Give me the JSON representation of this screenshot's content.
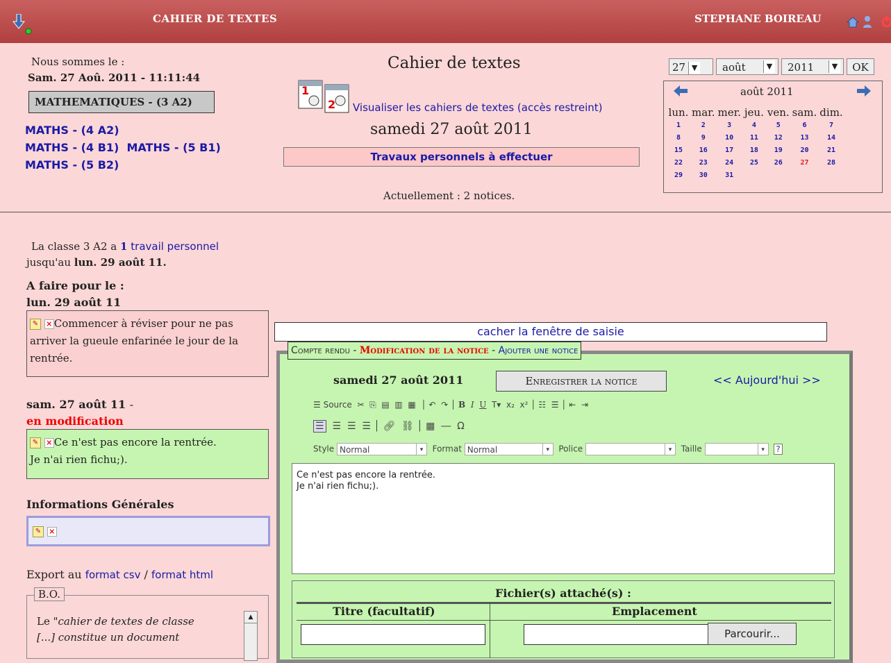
{
  "topbar": {
    "title": "CAHIER DE TEXTES",
    "user": "STEPHANE BOIREAU"
  },
  "header": {
    "date_intro": "Nous sommes le :",
    "datetime": "Sam. 27 Aoû. 2011 - 11:11:44",
    "current_class": "MATHEMATIQUES - (3 A2)",
    "other_classes": [
      "MATHS - (4 A2)",
      "MATHS - (4 B1)",
      "MATHS - (5 B1)",
      "MATHS - (5 B2)"
    ],
    "page_title": "Cahier de textes",
    "view_link": "Visualiser les cahiers de textes (accès restreint)",
    "selected_date": "samedi 27 août 2011",
    "travaux_button": "Travaux personnels à effectuer",
    "notices_count": "Actuellement : 2 notices."
  },
  "calendar": {
    "day_select": "27",
    "month_select": "août",
    "year_select": "2011",
    "ok_label": "OK",
    "month_title": "août 2011",
    "weekdays": [
      "lun.",
      "mar.",
      "mer.",
      "jeu.",
      "ven.",
      "sam.",
      "dim."
    ],
    "weeks": [
      [
        "1",
        "2",
        "3",
        "4",
        "5",
        "6",
        "7"
      ],
      [
        "8",
        "9",
        "10",
        "11",
        "12",
        "13",
        "14"
      ],
      [
        "15",
        "16",
        "17",
        "18",
        "19",
        "20",
        "21"
      ],
      [
        "22",
        "23",
        "24",
        "25",
        "26",
        "27",
        "28"
      ],
      [
        "29",
        "30",
        "31",
        "",
        "",
        "",
        ""
      ]
    ],
    "today": "27",
    "today_color": "#e02020"
  },
  "left": {
    "class_info_prefix": "La classe 3 A2 a",
    "count": "1",
    "travail_link": "travail personnel",
    "until_prefix": "jusqu'au",
    "until_date": "lun. 29 août 11.",
    "afaire_label": "A faire pour le :",
    "afaire_date": "lun. 29 août 11",
    "afaire_note": "Commencer à réviser pour ne pas arriver la gueule enfarinée le jour de la rentrée.",
    "current_date": "sam. 27 août 11",
    "current_sep": "-",
    "in_edit": "en modification",
    "current_note_line1": "Ce n'est pas encore la rentrée.",
    "current_note_line2": "Je n'ai rien fichu;).",
    "info_gen": "Informations Générales",
    "export_prefix": "Export au",
    "export_csv": "format csv",
    "export_sep": "/",
    "export_html": "format html",
    "bo_legend": "B.O.",
    "bo_text_line1a": "Le \"",
    "bo_text_line1b": "cahier de textes de classe",
    "bo_text_line2": "[...] constitue un document"
  },
  "editor": {
    "hide_link": "cacher la fenêtre de saisie",
    "tab_compte_rendu": "Compte rendu",
    "tab_sep": "-",
    "tab_modif": "Modification de la notice",
    "tab_sep2": "-",
    "tab_ajouter": "Ajouter une notice",
    "date": "samedi 27 août 2011",
    "save_button": "Enregistrer la notice",
    "nav": "<< Aujourd'hui >>",
    "toolbar_source": "Source",
    "style_label": "Style",
    "style_value": "Normal",
    "format_label": "Format",
    "format_value": "Normal",
    "police_label": "Police",
    "police_value": "",
    "taille_label": "Taille",
    "taille_value": "",
    "content_line1": "Ce n'est pas encore la rentrée.",
    "content_line2": "Je n'ai rien fichu;).",
    "attach_title": "Fichier(s) attaché(s) :",
    "col_title": "Titre (facultatif)",
    "col_location": "Emplacement",
    "browse_button": "Parcourir..."
  }
}
